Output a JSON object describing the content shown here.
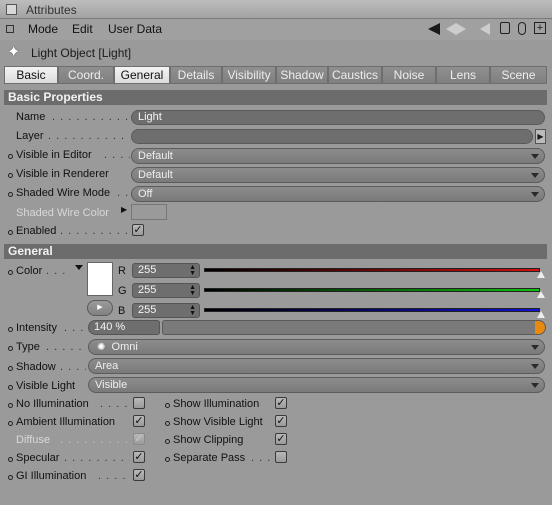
{
  "window": {
    "title": "Attributes"
  },
  "menu": {
    "mode": "Mode",
    "edit": "Edit",
    "user_data": "User Data"
  },
  "object": {
    "title": "Light Object [Light]"
  },
  "tabs": [
    "Basic",
    "Coord.",
    "General",
    "Details",
    "Visibility",
    "Shadow",
    "Caustics",
    "Noise",
    "Lens",
    "Scene"
  ],
  "active_tabs": [
    "Basic",
    "General"
  ],
  "basic": {
    "header": "Basic Properties",
    "name_label": "Name",
    "name_value": "Light",
    "layer_label": "Layer",
    "layer_value": "",
    "visible_editor_label": "Visible in Editor",
    "visible_editor_value": "Default",
    "visible_renderer_label": "Visible in Renderer",
    "visible_renderer_value": "Default",
    "shaded_wire_label": "Shaded Wire Mode",
    "shaded_wire_value": "Off",
    "shaded_wire_color_label": "Shaded Wire Color",
    "enabled_label": "Enabled",
    "enabled_checked": true
  },
  "general": {
    "header": "General",
    "color_label": "Color",
    "color_hex": "#ffffff",
    "r_label": "R",
    "r_value": "255",
    "g_label": "G",
    "g_value": "255",
    "b_label": "B",
    "b_value": "255",
    "intensity_label": "Intensity",
    "intensity_value": "140 %",
    "intensity_fraction": 1.0,
    "type_label": "Type",
    "type_value": "Omni",
    "shadow_label": "Shadow",
    "shadow_value": "Area",
    "visible_light_label": "Visible Light",
    "visible_light_value": "Visible",
    "no_illumination_label": "No Illumination",
    "ambient_illumination_label": "Ambient Illumination",
    "diffuse_label": "Diffuse",
    "specular_label": "Specular",
    "gi_illumination_label": "GI Illumination",
    "show_illumination_label": "Show Illumination",
    "show_visible_light_label": "Show Visible Light",
    "show_clipping_label": "Show Clipping",
    "separate_pass_label": "Separate Pass",
    "checks": {
      "no_illumination": false,
      "ambient_illumination": true,
      "diffuse": true,
      "specular": true,
      "gi_illumination": true,
      "show_illumination": true,
      "show_visible_light": true,
      "show_clipping": true,
      "separate_pass": false
    }
  },
  "colors": {
    "red": "#d01010",
    "green": "#10c010",
    "blue": "#1010d0",
    "intensity_end": "#e88a10"
  },
  "check_glyph": "✓"
}
